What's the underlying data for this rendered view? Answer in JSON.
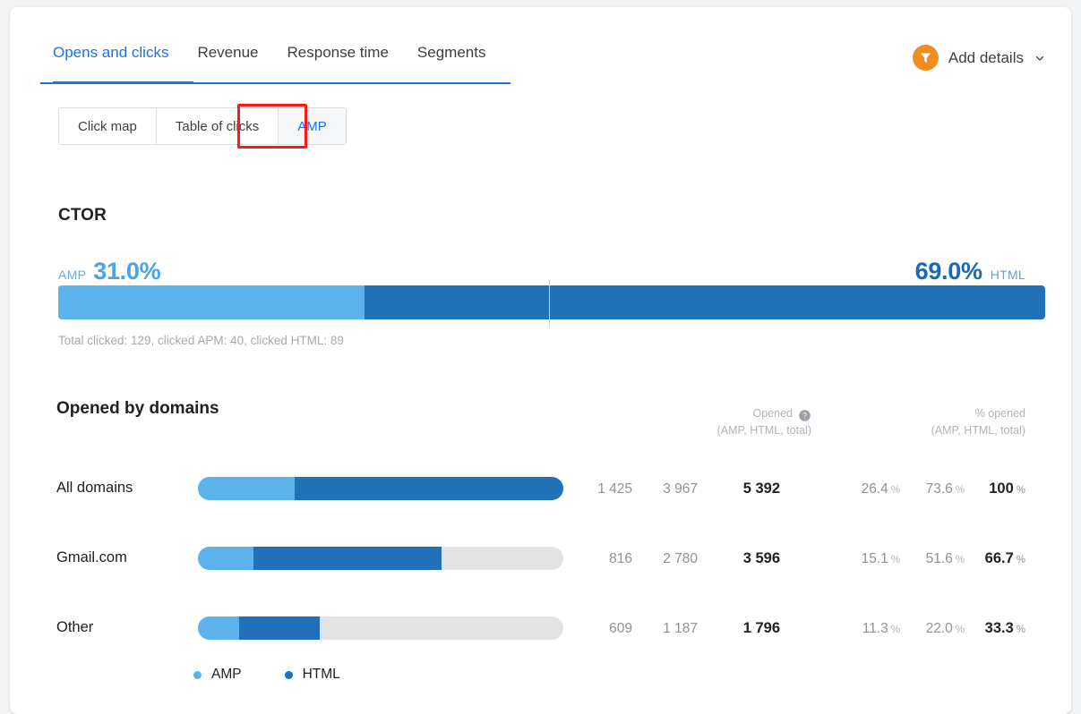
{
  "header": {
    "tabs": [
      {
        "label": "Opens and clicks",
        "active": true
      },
      {
        "label": "Revenue",
        "active": false
      },
      {
        "label": "Response time",
        "active": false
      },
      {
        "label": "Segments",
        "active": false
      }
    ],
    "add_details": {
      "label": "Add details",
      "icon": "funnel-icon",
      "chevron": "chevron-down-icon",
      "badge_color": "#f28b20"
    }
  },
  "segmented_control": {
    "options": [
      {
        "label": "Click map",
        "selected": false
      },
      {
        "label": "Table of clicks",
        "selected": false
      },
      {
        "label": "AMP",
        "selected": true
      }
    ],
    "highlight_color": "#fc1a18"
  },
  "ctor": {
    "title": "CTOR",
    "amp_tag": "AMP",
    "amp_value": "31.0%",
    "html_value": "69.0%",
    "html_tag": "HTML",
    "note": "Total clicked: 129, clicked APM: 40, clicked HTML: 89",
    "amp_pct": 31.0,
    "html_pct": 69.0
  },
  "domains": {
    "title": "Opened by domains",
    "columns": {
      "opened": {
        "line1": "Opened",
        "line2": "(AMP, HTML, total)",
        "help": "help-icon"
      },
      "percent": {
        "line1": "% opened",
        "line2": "(AMP, HTML, total)"
      }
    },
    "rows": [
      {
        "label": "All domains",
        "opened_amp": "1 425",
        "opened_html": "3 967",
        "opened_total": "5 392",
        "pct_amp": "26.4",
        "pct_html": "73.6",
        "pct_total": "100",
        "bar_amp": 26.4,
        "bar_html": 73.6
      },
      {
        "label": "Gmail.com",
        "opened_amp": "816",
        "opened_html": "2 780",
        "opened_total": "3 596",
        "pct_amp": "15.1",
        "pct_html": "51.6",
        "pct_total": "66.7",
        "bar_amp": 15.1,
        "bar_html": 51.6
      },
      {
        "label": "Other",
        "opened_amp": "609",
        "opened_html": "1 187",
        "opened_total": "1 796",
        "pct_amp": "11.3",
        "pct_html": "22.0",
        "pct_total": "33.3",
        "bar_amp": 11.3,
        "bar_html": 22.0
      }
    ],
    "percent_symbol": "%",
    "legend": [
      {
        "label": "AMP",
        "color": "#5cb3ec"
      },
      {
        "label": "HTML",
        "color": "#2071b8"
      }
    ]
  },
  "chart_data": {
    "type": "bar",
    "title": "CTOR / Opened by domains",
    "ctor_split": {
      "categories": [
        "AMP",
        "HTML"
      ],
      "values": [
        31.0,
        69.0
      ],
      "unit": "%"
    },
    "categories": [
      "All domains",
      "Gmail.com",
      "Other"
    ],
    "series": [
      {
        "name": "AMP",
        "values": [
          26.4,
          15.1,
          11.3
        ],
        "color": "#5cb3ec"
      },
      {
        "name": "HTML",
        "values": [
          73.6,
          51.6,
          22.0
        ],
        "color": "#2071b8"
      }
    ],
    "counts": {
      "AMP": [
        1425,
        816,
        609
      ],
      "HTML": [
        3967,
        2780,
        1187
      ],
      "total": [
        5392,
        3596,
        1796
      ]
    },
    "totals_pct": [
      100,
      66.7,
      33.3
    ],
    "xlabel": "",
    "ylabel": "% opened",
    "ylim": [
      0,
      100
    ],
    "grid": false,
    "legend_position": "bottom"
  }
}
